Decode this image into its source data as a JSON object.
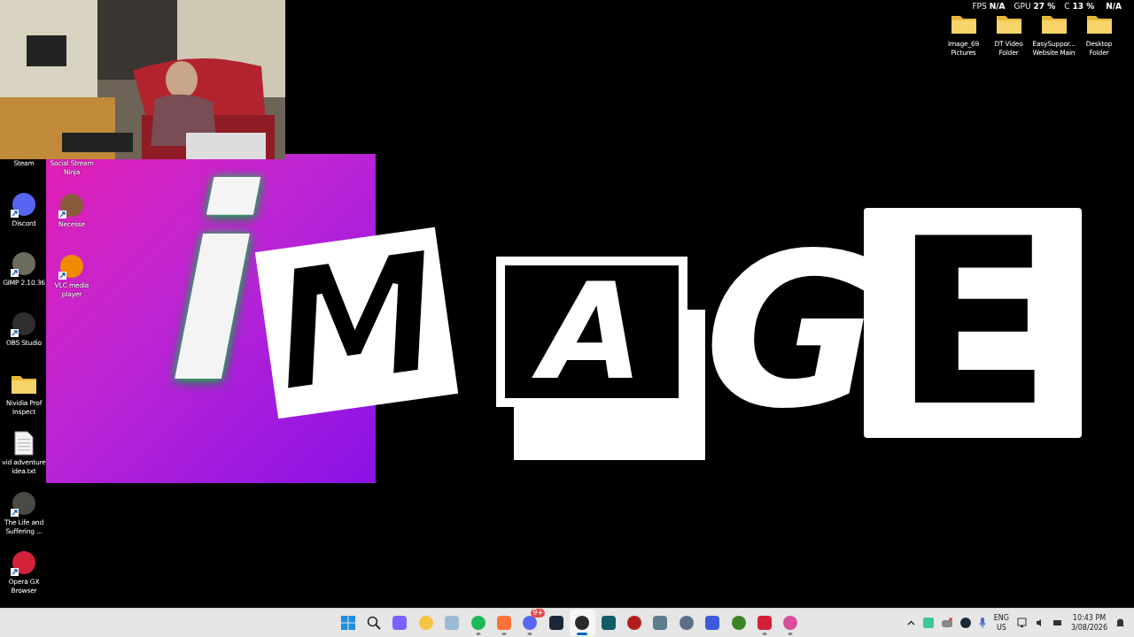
{
  "overlay_stats": [
    {
      "label": "FPS",
      "value": "N/A"
    },
    {
      "label": "GPU",
      "value": "27 %"
    },
    {
      "label": "C",
      "value": "13 %"
    },
    {
      "value": "N/A"
    }
  ],
  "top_icons": [
    {
      "kind": "folder",
      "lines": [
        "Image_69",
        "Pictures"
      ]
    },
    {
      "kind": "folder",
      "lines": [
        "DT Video",
        "Folder"
      ]
    },
    {
      "kind": "folder",
      "lines": [
        "EasySuppor...",
        "Website Main"
      ]
    },
    {
      "kind": "folder",
      "lines": [
        "Desktop",
        "Folder"
      ]
    }
  ],
  "desktop_columns": [
    [
      {
        "kind": "label_only",
        "lines": [
          "Steam"
        ]
      },
      {
        "kind": "app",
        "color": "#5865f2",
        "shortcut": true,
        "lines": [
          "Discord"
        ]
      },
      {
        "kind": "app",
        "color": "#6b6b5e",
        "shortcut": true,
        "lines": [
          "GIMP 2.10.36"
        ]
      },
      {
        "kind": "app",
        "color": "#302e31",
        "shortcut": true,
        "lines": [
          "OBS Studio"
        ]
      },
      {
        "kind": "folder",
        "lines": [
          "Nividia Prof",
          "Inspect"
        ]
      },
      {
        "kind": "document",
        "lines": [
          "vid adventure",
          "idea.txt"
        ]
      },
      {
        "kind": "app",
        "color": "#4a4a44",
        "shortcut": true,
        "lines": [
          "The Life and",
          "Suffering ..."
        ]
      },
      {
        "kind": "app",
        "color": "#d3213a",
        "shortcut": true,
        "lines": [
          "Opera GX",
          "Browser"
        ]
      }
    ],
    [
      {
        "kind": "label_only",
        "lines": [
          "Social Stream",
          "Ninja"
        ]
      },
      {
        "kind": "app",
        "color": "#8a5a3c",
        "shortcut": true,
        "lines": [
          "Necesse"
        ]
      },
      {
        "kind": "app",
        "color": "#f08a00",
        "shortcut": true,
        "lines": [
          "VLC media",
          "player"
        ]
      }
    ]
  ],
  "logo": {
    "letters": [
      "i",
      "M",
      "A",
      "G",
      "E"
    ]
  },
  "taskbar": {
    "apps": [
      {
        "color": "#7b61ff",
        "running": false,
        "selected": false
      },
      {
        "color": "#f4c542",
        "running": false,
        "selected": false
      },
      {
        "color": "#9bbbd4",
        "running": false,
        "selected": false
      },
      {
        "color": "#1db954",
        "running": true,
        "selected": false
      },
      {
        "color": "#ff7139",
        "running": true,
        "selected": false
      },
      {
        "color": "#5865f2",
        "running": true,
        "selected": false,
        "badge": "9+"
      },
      {
        "color": "#1b2838",
        "running": false,
        "selected": false
      },
      {
        "color": "#2b2b2b",
        "running": true,
        "selected": true
      },
      {
        "color": "#0f5b66",
        "running": false,
        "selected": false
      },
      {
        "color": "#b51d1d",
        "running": false,
        "selected": false
      },
      {
        "color": "#607d8b",
        "running": false,
        "selected": false
      },
      {
        "color": "#5a6f86",
        "running": false,
        "selected": false
      },
      {
        "color": "#3b5bdb",
        "running": false,
        "selected": false
      },
      {
        "color": "#3c8527",
        "running": false,
        "selected": false
      },
      {
        "color": "#d3213a",
        "running": true,
        "selected": false
      },
      {
        "color": "#d94f9b",
        "running": true,
        "selected": false
      }
    ],
    "language": [
      "ENG",
      "US"
    ],
    "time": "10:43 PM",
    "date": "3/08/2026"
  }
}
